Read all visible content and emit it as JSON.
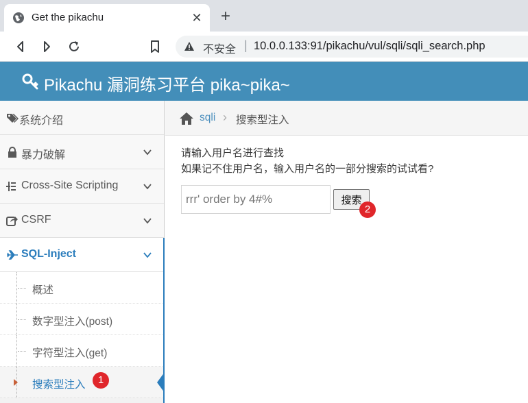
{
  "browser": {
    "tab_title": "Get the pikachu",
    "tab_close": "✕",
    "new_tab": "+",
    "address_insecure": "不安全",
    "address_sep": "|",
    "address_url": "10.0.0.133:91/pikachu/vul/sqli/sqli_search.php"
  },
  "header": {
    "title": "Pikachu 漏洞练习平台 pika~pika~"
  },
  "sidebar": {
    "items": [
      {
        "label": "系统介绍",
        "icon": "tags-icon"
      },
      {
        "label": "暴力破解",
        "icon": "lock-icon"
      },
      {
        "label": "Cross-Site Scripting",
        "icon": "sitemap-icon"
      },
      {
        "label": "CSRF",
        "icon": "share-icon"
      },
      {
        "label": "SQL-Inject",
        "icon": "plane-icon"
      }
    ],
    "sub_items": [
      {
        "label": "概述"
      },
      {
        "label": "数字型注入(post)"
      },
      {
        "label": "字符型注入(get)"
      },
      {
        "label": "搜索型注入"
      }
    ]
  },
  "breadcrumb": {
    "link": "sqli",
    "sep": "›",
    "current": "搜索型注入"
  },
  "main": {
    "hint1": "请输入用户名进行查找",
    "hint2": "如果记不住用户名，输入用户名的一部分搜索的试试看?",
    "search_value": "rrr' order by 4#%",
    "search_button": "搜索"
  },
  "annotations": {
    "badge1": "1",
    "badge2": "2"
  }
}
